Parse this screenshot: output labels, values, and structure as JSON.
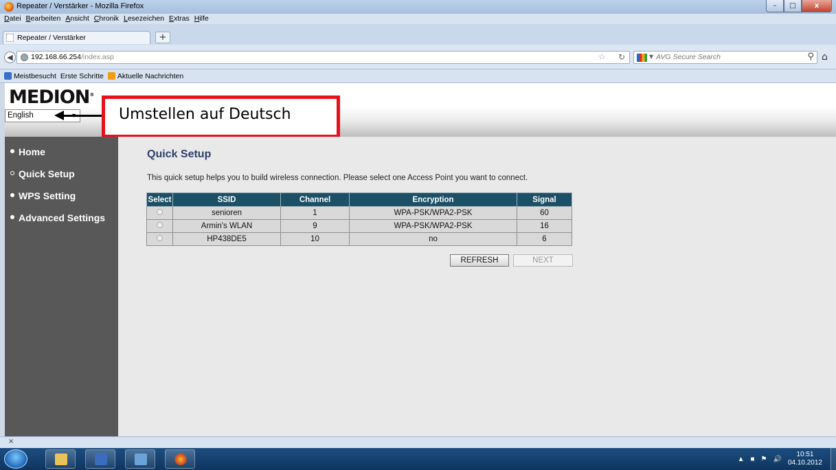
{
  "window": {
    "title": "Repeater / Verstärker - Mozilla Firefox",
    "minimize_glyph": "–",
    "maximize_glyph": "□",
    "close_glyph": "x"
  },
  "menubar": [
    "Datei",
    "Bearbeiten",
    "Ansicht",
    "Chronik",
    "Lesezeichen",
    "Extras",
    "Hilfe"
  ],
  "tab": {
    "label": "Repeater / Verstärker",
    "new_tab_glyph": "+"
  },
  "navbar": {
    "url_host": "192.168.66.254",
    "url_path": "/index.asp",
    "search_placeholder": "AVG Secure Search"
  },
  "bookmarks": [
    "Meistbesucht",
    "Erste Schritte",
    "Aktuelle Nachrichten"
  ],
  "page": {
    "logo": "MEDION",
    "language_selected": "English",
    "annotation": "Umstellen auf Deutsch",
    "nav": [
      {
        "label": "Home",
        "active": false
      },
      {
        "label": "Quick Setup",
        "active": true
      },
      {
        "label": "WPS Setting",
        "active": false
      },
      {
        "label": "Advanced Settings",
        "active": false
      }
    ],
    "heading": "Quick Setup",
    "description": "This quick setup helps you to build wireless connection. Please select one Access Point you want to connect.",
    "table": {
      "headers": [
        "Select",
        "SSID",
        "Channel",
        "Encryption",
        "Signal"
      ],
      "rows": [
        {
          "ssid": "senioren",
          "channel": "1",
          "encryption": "WPA-PSK/WPA2-PSK",
          "signal": "60"
        },
        {
          "ssid": "Armin's WLAN",
          "channel": "9",
          "encryption": "WPA-PSK/WPA2-PSK",
          "signal": "16"
        },
        {
          "ssid": "HP438DE5",
          "channel": "10",
          "encryption": "no",
          "signal": "6"
        }
      ]
    },
    "refresh_label": "REFRESH",
    "next_label": "NEXT"
  },
  "findbar": {
    "close_glyph": "×"
  },
  "taskbar": {
    "time": "10:51",
    "date": "04.10.2012",
    "colors": {
      "taskbar": "#1c4d80",
      "sidebar": "#585858",
      "table_header": "#1c5066",
      "annotation_border": "#e8101a"
    }
  }
}
